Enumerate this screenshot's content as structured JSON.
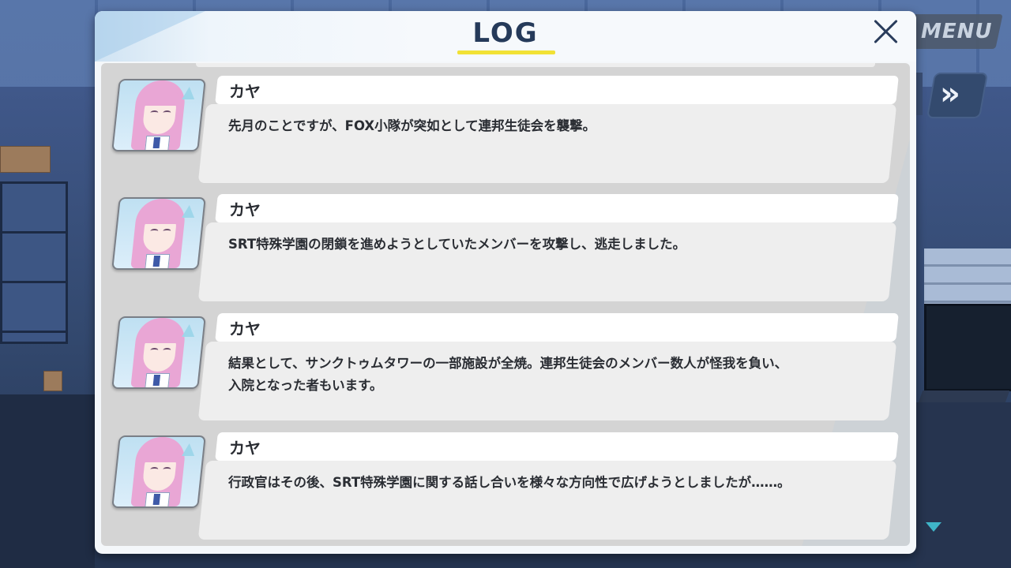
{
  "menu": {
    "label": "MENU",
    "skip_icon": "fast-forward-icon"
  },
  "log": {
    "title": "LOG",
    "close_icon": "close-icon",
    "entries": [
      {
        "speaker": "カヤ",
        "text": "先月のことですが、FOX小隊が突如として連邦生徒会を襲撃。"
      },
      {
        "speaker": "カヤ",
        "text": "SRT特殊学園の閉鎖を進めようとしていたメンバーを攻撃し、逃走しました。"
      },
      {
        "speaker": "カヤ",
        "text": "結果として、サンクトゥムタワーの一部施設が全焼。連邦生徒会のメンバー数人が怪我を負い、入院となった者もいます。"
      },
      {
        "speaker": "カヤ",
        "text": "行政官はその後、SRT特殊学園に関する話し合いを様々な方向性で広げようとしましたが……。"
      }
    ]
  },
  "colors": {
    "accent_underline": "#f1e135",
    "title": "#253a5a",
    "scroll_arrow": "#3fb5c8"
  }
}
